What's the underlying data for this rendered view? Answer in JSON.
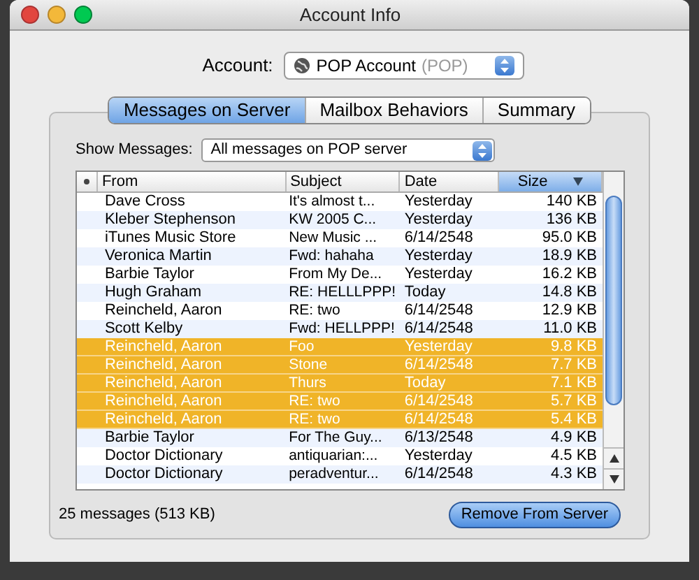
{
  "window": {
    "title": "Account Info"
  },
  "account": {
    "label": "Account:",
    "value": "POP Account",
    "detail": "(POP)"
  },
  "tabs": [
    {
      "label": "Messages on Server",
      "selected": true
    },
    {
      "label": "Mailbox Behaviors",
      "selected": false
    },
    {
      "label": "Summary",
      "selected": false
    }
  ],
  "show_messages": {
    "label": "Show Messages:",
    "value": "All messages on POP server"
  },
  "table": {
    "columns": [
      {
        "label": "From",
        "sorted": false
      },
      {
        "label": "Subject",
        "sorted": false
      },
      {
        "label": "Date",
        "sorted": false
      },
      {
        "label": "Size",
        "sorted": true
      }
    ],
    "rows": [
      {
        "from": "Dave Cross",
        "subject": "It's almost t...",
        "date": "Yesterday",
        "size": "140 KB",
        "selected": false
      },
      {
        "from": "Kleber Stephenson",
        "subject": "KW 2005 C...",
        "date": "Yesterday",
        "size": "136 KB",
        "selected": false
      },
      {
        "from": "iTunes Music Store",
        "subject": "New Music ...",
        "date": "6/14/2548",
        "size": "95.0 KB",
        "selected": false
      },
      {
        "from": "Veronica Martin",
        "subject": "Fwd: hahaha",
        "date": "Yesterday",
        "size": "18.9 KB",
        "selected": false
      },
      {
        "from": "Barbie Taylor",
        "subject": "From My De...",
        "date": "Yesterday",
        "size": "16.2 KB",
        "selected": false
      },
      {
        "from": "Hugh Graham",
        "subject": "RE: HELLLPPP!",
        "date": "Today",
        "size": "14.8 KB",
        "selected": false
      },
      {
        "from": "Reincheld, Aaron",
        "subject": "RE: two",
        "date": "6/14/2548",
        "size": "12.9 KB",
        "selected": false
      },
      {
        "from": "Scott Kelby",
        "subject": "Fwd: HELLPPP!",
        "date": "6/14/2548",
        "size": "11.0 KB",
        "selected": false
      },
      {
        "from": "Reincheld, Aaron",
        "subject": "Foo",
        "date": "Yesterday",
        "size": "9.8 KB",
        "selected": true
      },
      {
        "from": "Reincheld, Aaron",
        "subject": "Stone",
        "date": "6/14/2548",
        "size": "7.7 KB",
        "selected": true
      },
      {
        "from": "Reincheld, Aaron",
        "subject": "Thurs",
        "date": "Today",
        "size": "7.1 KB",
        "selected": true
      },
      {
        "from": "Reincheld, Aaron",
        "subject": "RE: two",
        "date": "6/14/2548",
        "size": "5.7 KB",
        "selected": true
      },
      {
        "from": "Reincheld, Aaron",
        "subject": "RE: two",
        "date": "6/14/2548",
        "size": "5.4 KB",
        "selected": true
      },
      {
        "from": "Barbie Taylor",
        "subject": "For The Guy...",
        "date": "6/13/2548",
        "size": "4.9 KB",
        "selected": false
      },
      {
        "from": "Doctor Dictionary",
        "subject": "antiquarian:...",
        "date": "Yesterday",
        "size": "4.5 KB",
        "selected": false
      },
      {
        "from": "Doctor Dictionary",
        "subject": "peradventur...",
        "date": "6/14/2548",
        "size": "4.3 KB",
        "selected": false
      }
    ]
  },
  "status": "25 messages (513 KB)",
  "buttons": [
    {
      "label": "Remove From Server",
      "default": true
    }
  ]
}
